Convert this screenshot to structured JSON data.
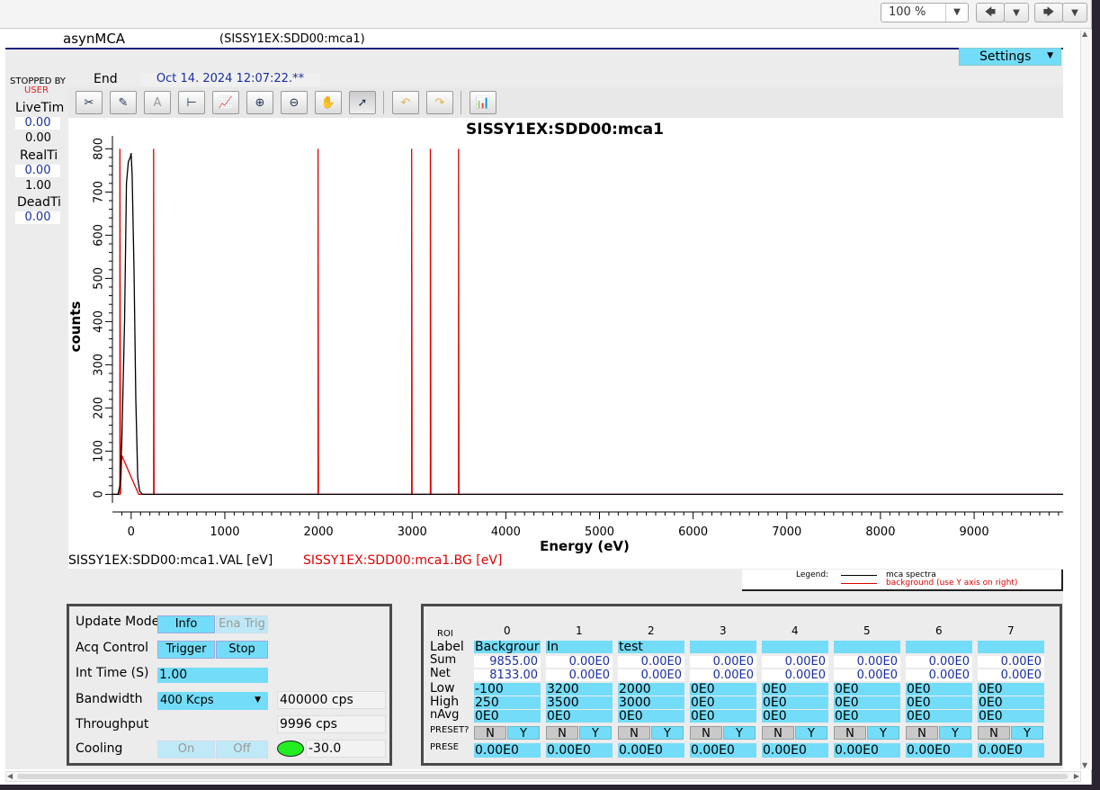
{
  "browser": {
    "zoom": "100 %"
  },
  "app": {
    "title": "asynMCA",
    "pv": "(SISSY1EX:SDD00:mca1)",
    "settings_label": "Settings"
  },
  "status": {
    "stopped_by": "STOPPED BY",
    "user": "USER",
    "end_label": "End",
    "end_time": "Oct 14. 2024 12:07:22.**",
    "live_label": "LiveTim",
    "live_value": "0.00",
    "live_preset": "0.00",
    "real_label": "RealTi",
    "real_value": "0.00",
    "real_preset": "1.00",
    "dead_label": "DeadTi",
    "dead_value": "0.00"
  },
  "plot": {
    "title": "SISSY1EX:SDD00:mca1",
    "ylabel": "counts",
    "xlabel": "Energy (eV)",
    "y_ticks": [
      "0",
      "100",
      "200",
      "300",
      "400",
      "500",
      "600",
      "700",
      "800"
    ],
    "x_ticks": [
      "0",
      "1000",
      "2000",
      "3000",
      "4000",
      "5000",
      "6000",
      "7000",
      "8000",
      "9000"
    ],
    "trace_val": "SISSY1EX:SDD00:mca1.VAL [eV]",
    "trace_bg": "SISSY1EX:SDD00:mca1.BG [eV]",
    "legend_title": "Legend:",
    "legend_series1": "mca spectra",
    "legend_series2": "background (use Y axis on right)"
  },
  "chart_data": {
    "type": "line",
    "title": "SISSY1EX:SDD00:mca1",
    "xlabel": "Energy (eV)",
    "ylabel": "counts",
    "xlim": [
      -200,
      9950
    ],
    "ylim": [
      -20,
      830
    ],
    "grid": false,
    "legend": "bottom-right",
    "series": [
      {
        "name": "mca spectra",
        "color": "#000000",
        "x": [
          -200,
          -140,
          -120,
          -100,
          -70,
          -50,
          -30,
          -10,
          0,
          10,
          30,
          50,
          70,
          90,
          120,
          160,
          200,
          9950
        ],
        "y": [
          0,
          0,
          20,
          120,
          400,
          720,
          770,
          780,
          790,
          740,
          520,
          220,
          40,
          8,
          0,
          0,
          0,
          0
        ]
      },
      {
        "name": "background (use Y axis on right)",
        "color": "#dd0000",
        "x": [
          -200,
          -120,
          -120,
          -115,
          -100,
          -60,
          -20,
          20,
          60,
          80,
          100,
          240,
          240,
          245,
          250,
          1995,
          1995,
          2000,
          2005,
          2995,
          2995,
          3000,
          3005,
          3195,
          3195,
          3200,
          3205,
          3495,
          3495,
          3500,
          3505,
          9950
        ],
        "y": [
          0,
          0,
          800,
          0,
          90,
          70,
          50,
          30,
          10,
          0,
          0,
          0,
          800,
          0,
          0,
          0,
          800,
          0,
          0,
          0,
          800,
          0,
          0,
          0,
          800,
          0,
          0,
          0,
          800,
          0,
          0,
          0
        ]
      }
    ]
  },
  "controls": {
    "update_mode": "Update Mode",
    "info": "Info",
    "ena_trig": "Ena Trig",
    "acq_control": "Acq Control",
    "trigger": "Trigger",
    "stop": "Stop",
    "int_time_label": "Int Time (S)",
    "int_time": "1.00",
    "bandwidth_label": "Bandwidth",
    "bandwidth": "400 Kcps",
    "bandwidth_cps": "400000 cps",
    "throughput_label": "Throughput",
    "throughput": "9996 cps",
    "cooling_label": "Cooling",
    "on": "On",
    "off": "Off",
    "temperature": "-30.0",
    "led_color": "#22ee22"
  },
  "roi": {
    "header": "ROI",
    "row_labels": [
      "Label",
      "Sum",
      "Net",
      "Low",
      "High",
      "nAvg",
      "PRESET?",
      "PRESE"
    ],
    "cols": [
      {
        "idx": "0",
        "label": "Backgrour",
        "sum": "9855.00",
        "net": "8133.00",
        "low": "-100",
        "high": "250",
        "navg": "0E0",
        "preset": "0.00E0"
      },
      {
        "idx": "1",
        "label": "In",
        "sum": "0.00E0",
        "net": "0.00E0",
        "low": "3200",
        "high": "3500",
        "navg": "0E0",
        "preset": "0.00E0"
      },
      {
        "idx": "2",
        "label": "test",
        "sum": "0.00E0",
        "net": "0.00E0",
        "low": "2000",
        "high": "3000",
        "navg": "0E0",
        "preset": "0.00E0"
      },
      {
        "idx": "3",
        "label": "",
        "sum": "0.00E0",
        "net": "0.00E0",
        "low": "0E0",
        "high": "0E0",
        "navg": "0E0",
        "preset": "0.00E0"
      },
      {
        "idx": "4",
        "label": "",
        "sum": "0.00E0",
        "net": "0.00E0",
        "low": "0E0",
        "high": "0E0",
        "navg": "0E0",
        "preset": "0.00E0"
      },
      {
        "idx": "5",
        "label": "",
        "sum": "0.00E0",
        "net": "0.00E0",
        "low": "0E0",
        "high": "0E0",
        "navg": "0E0",
        "preset": "0.00E0"
      },
      {
        "idx": "6",
        "label": "",
        "sum": "0.00E0",
        "net": "0.00E0",
        "low": "0E0",
        "high": "0E0",
        "navg": "0E0",
        "preset": "0.00E0"
      },
      {
        "idx": "7",
        "label": "",
        "sum": "0.00E0",
        "net": "0.00E0",
        "low": "0E0",
        "high": "0E0",
        "navg": "0E0",
        "preset": "0.00E0"
      }
    ],
    "n": "N",
    "y": "Y"
  }
}
